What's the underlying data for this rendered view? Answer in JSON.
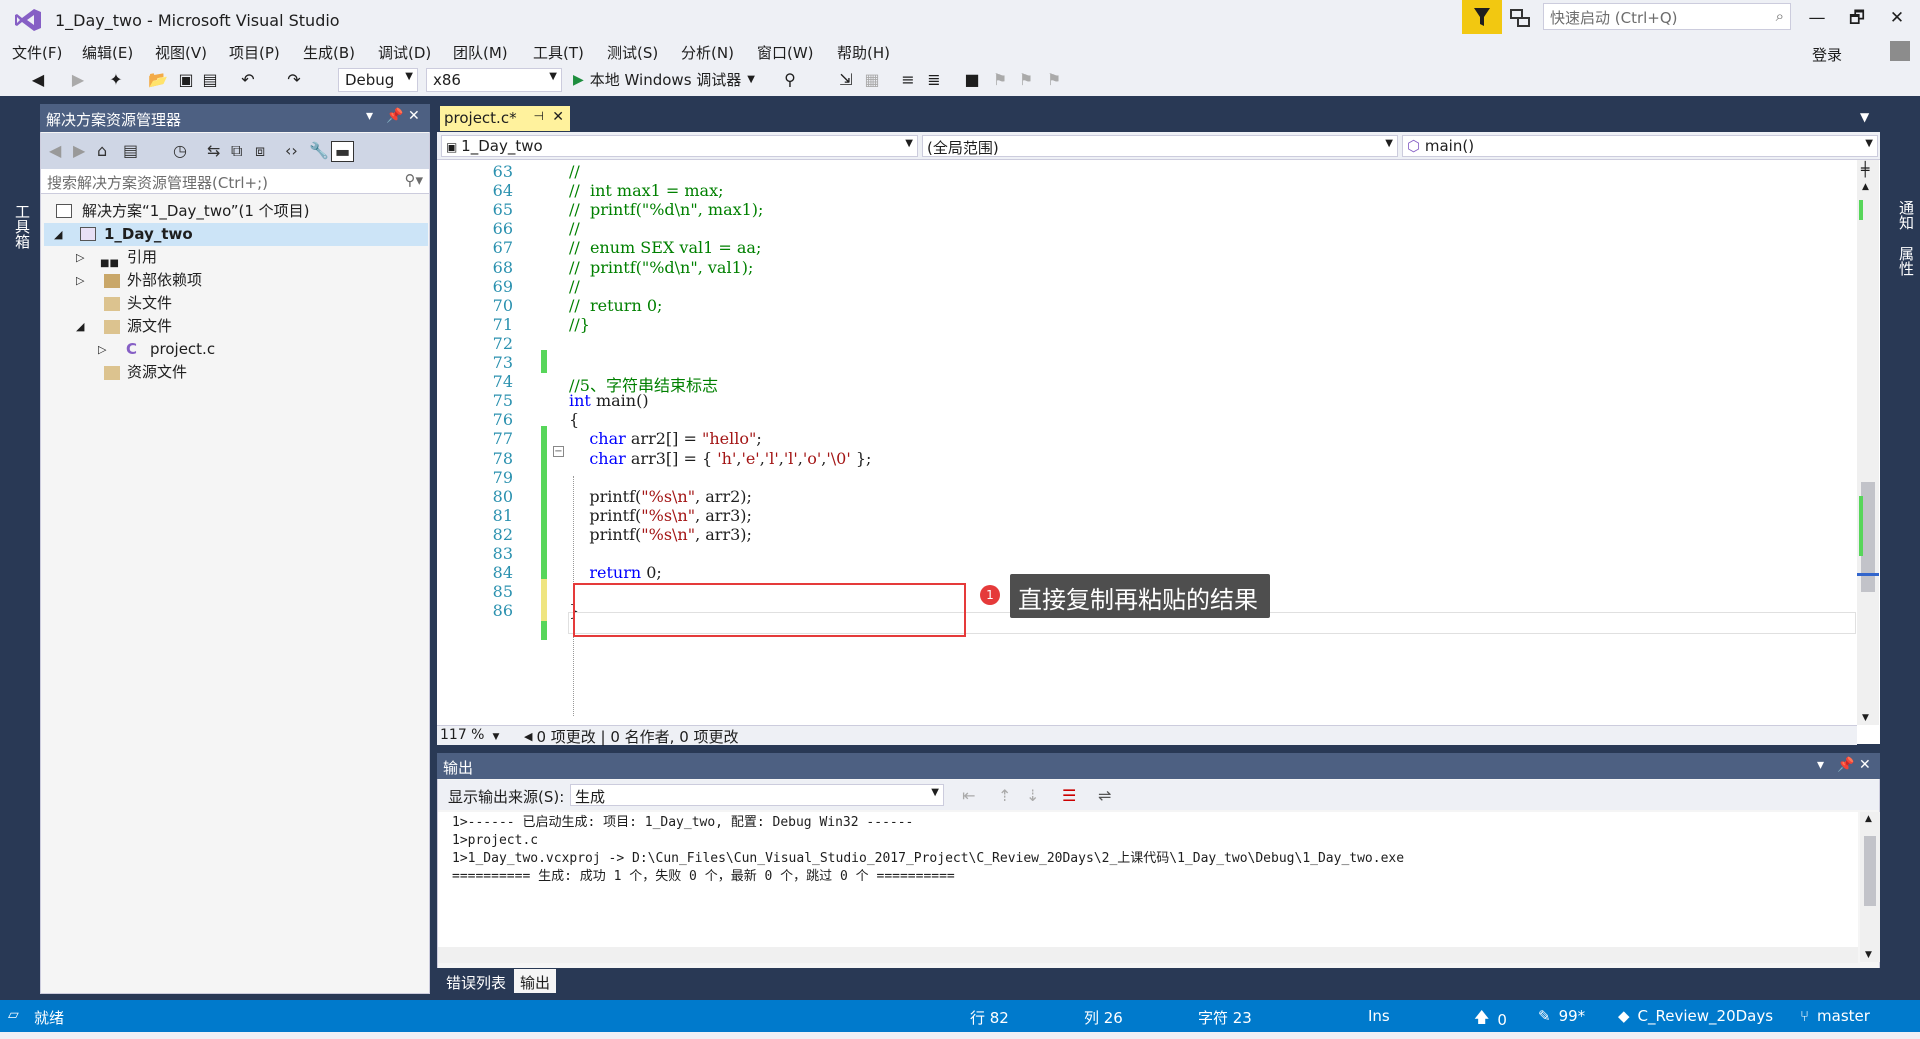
{
  "window": {
    "title": "1_Day_two - Microsoft Visual Studio",
    "quick_launch_placeholder": "快速启动 (Ctrl+Q)",
    "minimize": "—",
    "maximize": "🗗",
    "close": "✕"
  },
  "menu": [
    "文件(F)",
    "编辑(E)",
    "视图(V)",
    "项目(P)",
    "生成(B)",
    "调试(D)",
    "团队(M)",
    "工具(T)",
    "测试(S)",
    "分析(N)",
    "窗口(W)",
    "帮助(H)"
  ],
  "login": "登录",
  "toolbar": {
    "config": "Debug",
    "platform": "x86",
    "debugger": "本地 Windows 调试器"
  },
  "side": {
    "left_strip": "工具箱",
    "right_strip_1": "通知",
    "right_strip_2": "属性"
  },
  "solution_explorer": {
    "title": "解决方案资源管理器",
    "search_placeholder": "搜索解决方案资源管理器(Ctrl+;)",
    "items": [
      {
        "label": "解决方案“1_Day_two”(1 个项目)"
      },
      {
        "label": "1_Day_two"
      },
      {
        "label": "引用"
      },
      {
        "label": "外部依赖项"
      },
      {
        "label": "头文件"
      },
      {
        "label": "源文件"
      },
      {
        "label": "project.c"
      },
      {
        "label": "资源文件"
      }
    ]
  },
  "editor": {
    "tab": "project.c*",
    "nav_project": "1_Day_two",
    "nav_scope": "(全局范围)",
    "nav_function": "main()",
    "zoom": "117 %",
    "changes": "0 项更改 | 0 名作者, 0 项更改",
    "lines": [
      {
        "n": "63",
        "code": "//"
      },
      {
        "n": "64",
        "code": "//  int max1 = max;"
      },
      {
        "n": "65",
        "code": "//  printf(\"%d\\n\", max1);"
      },
      {
        "n": "66",
        "code": "//"
      },
      {
        "n": "67",
        "code": "//  enum SEX val1 = aa;"
      },
      {
        "n": "68",
        "code": "//  printf(\"%d\\n\", val1);"
      },
      {
        "n": "69",
        "code": "//"
      },
      {
        "n": "70",
        "code": "//  return 0;"
      },
      {
        "n": "71",
        "code": "//}"
      },
      {
        "n": "72",
        "code": ""
      },
      {
        "n": "73",
        "code": ""
      },
      {
        "n": "74",
        "code": "//5、字符串结束标志"
      },
      {
        "n": "75",
        "code": "int main()"
      },
      {
        "n": "76",
        "code": "{"
      },
      {
        "n": "77",
        "code": "    char arr2[] = \"hello\";"
      },
      {
        "n": "78",
        "code": "    char arr3[] = { 'h','e','l','l','o','\\0' };"
      },
      {
        "n": "79",
        "code": ""
      },
      {
        "n": "80",
        "code": "    printf(\"%s\\n\", arr2);"
      },
      {
        "n": "81",
        "code": "    printf(\"%s\\n\", arr3);"
      },
      {
        "n": "82",
        "code": "    printf(\"%s\\n\", arr3);"
      },
      {
        "n": "83",
        "code": ""
      },
      {
        "n": "84",
        "code": "    return 0;"
      },
      {
        "n": "85",
        "code": ""
      },
      {
        "n": "86",
        "code": "}"
      }
    ],
    "callout_number": "1",
    "callout_text": "直接复制再粘贴的结果"
  },
  "output": {
    "title": "输出",
    "source_label": "显示输出来源(S):",
    "source_value": "生成",
    "lines": [
      "1>------ 已启动生成: 项目: 1_Day_two, 配置: Debug Win32 ------",
      "1>project.c",
      "1>1_Day_two.vcxproj -> D:\\Cun_Files\\Cun_Visual_Studio_2017_Project\\C_Review_20Days\\2_上课代码\\1_Day_two\\Debug\\1_Day_two.exe",
      "========== 生成: 成功 1 个，失败 0 个，最新 0 个，跳过 0 个 =========="
    ],
    "tabs": [
      "错误列表",
      "输出"
    ]
  },
  "statusbar": {
    "state": "就绪",
    "row": "行 82",
    "col": "列 26",
    "char": "字符 23",
    "mode": "Ins",
    "up": "0",
    "edits": "99*",
    "repo": "C_Review_20Days",
    "branch": "master"
  },
  "colors": {
    "accent": "#007acc",
    "panel_header": "#4d6082",
    "tab_active": "#fff29d",
    "highlight_red": "#e53a3a"
  }
}
